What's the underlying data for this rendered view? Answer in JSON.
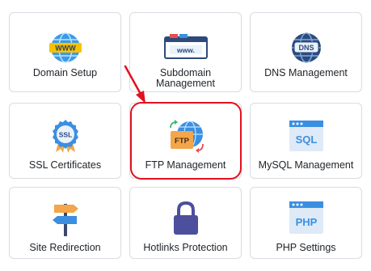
{
  "tiles": [
    {
      "label": "Domain Setup",
      "icon": "globe-www-icon"
    },
    {
      "label": "Subdomain Management",
      "icon": "www-address-bar-icon"
    },
    {
      "label": "DNS Management",
      "icon": "dns-globe-icon"
    },
    {
      "label": "SSL Certificates",
      "icon": "ssl-badge-icon"
    },
    {
      "label": "FTP Management",
      "icon": "ftp-globe-icon"
    },
    {
      "label": "MySQL Management",
      "icon": "sql-window-icon"
    },
    {
      "label": "Site Redirection",
      "icon": "signpost-icon"
    },
    {
      "label": "Hotlinks Protection",
      "icon": "padlock-icon"
    },
    {
      "label": "PHP Settings",
      "icon": "php-window-icon"
    }
  ],
  "icon_text": {
    "www": "WWW",
    "www_bar": "www.",
    "dns": "DNS",
    "ssl": "SSL",
    "ftp": "FTP",
    "sql": "SQL",
    "php": "PHP"
  },
  "colors": {
    "highlight": "#e3101f",
    "tile_border": "#d9dce1",
    "icon_blue": "#3b8fe0",
    "icon_navy": "#2c4a7c",
    "icon_orange": "#f3a64a",
    "icon_yellow": "#f6c200",
    "icon_purple": "#4b4f9c"
  }
}
